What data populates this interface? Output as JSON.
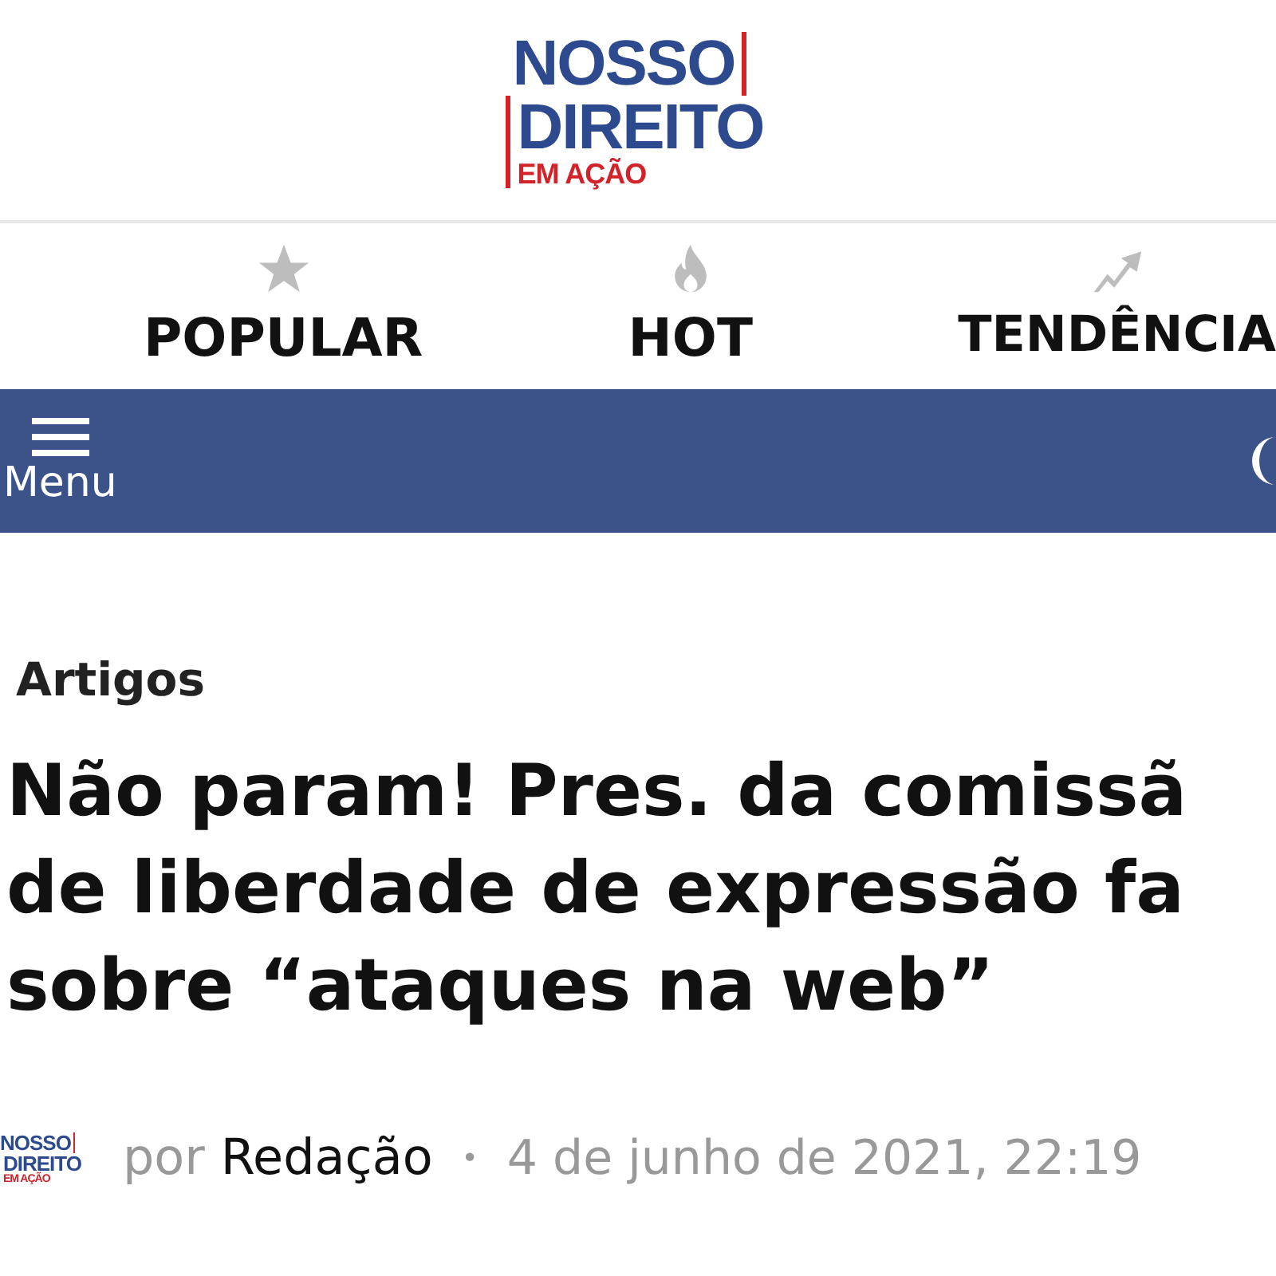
{
  "logo": {
    "line_1": "NOSSO",
    "line_2": "DIREITO",
    "tagline": "EM AÇÃO"
  },
  "nav": [
    {
      "kind": "star",
      "label": "POPULAR"
    },
    {
      "kind": "flame",
      "label": "HOT"
    },
    {
      "kind": "trend",
      "label": "TENDÊNCIA"
    }
  ],
  "menu_bar": {
    "label": "Menu"
  },
  "article": {
    "category": "Artigos",
    "title_lines": [
      "Não param! Pres. da comissã",
      "de liberdade de expressão fa",
      "sobre “ataques na web”"
    ],
    "byline": {
      "logo": {
        "line_1": "NOSSO",
        "line_2": "DIREITO",
        "tagline": "EM AÇÃO"
      },
      "prefix": "por",
      "author": "Redação",
      "separator": "•",
      "date": "4 de junho de 2021, 22:19"
    }
  }
}
